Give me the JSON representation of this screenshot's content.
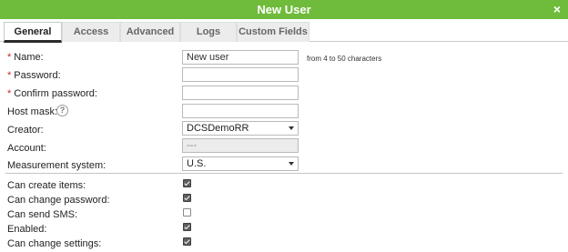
{
  "window": {
    "title": "New User",
    "close_glyph": "×"
  },
  "tabs": [
    {
      "label": "General",
      "active": true
    },
    {
      "label": "Access",
      "active": false
    },
    {
      "label": "Advanced",
      "active": false
    },
    {
      "label": "Logs",
      "active": false
    },
    {
      "label": "Custom Fields",
      "active": false
    }
  ],
  "form": {
    "name": {
      "label": "Name:",
      "required": true,
      "value": "New user",
      "hint": "from 4 to 50 characters"
    },
    "password": {
      "label": "Password:",
      "required": true,
      "value": ""
    },
    "confirm_password": {
      "label": "Confirm password:",
      "required": true,
      "value": ""
    },
    "host_mask": {
      "label": "Host mask:",
      "value": "",
      "help_glyph": "?"
    },
    "creator": {
      "label": "Creator:",
      "value": "DCSDemoRR"
    },
    "account": {
      "label": "Account:",
      "value": "---"
    },
    "measurement_system": {
      "label": "Measurement system:",
      "value": "U.S."
    },
    "required_marker": "*"
  },
  "permissions": [
    {
      "label": "Can create items:",
      "checked": true
    },
    {
      "label": "Can change password:",
      "checked": true
    },
    {
      "label": "Can send SMS:",
      "checked": false
    },
    {
      "label": "Enabled:",
      "checked": true
    },
    {
      "label": "Can change settings:",
      "checked": true
    }
  ],
  "colors": {
    "titlebar": "#6fbb3c",
    "required": "#cc2222",
    "active_tab_underline": "#2a2a2a"
  }
}
